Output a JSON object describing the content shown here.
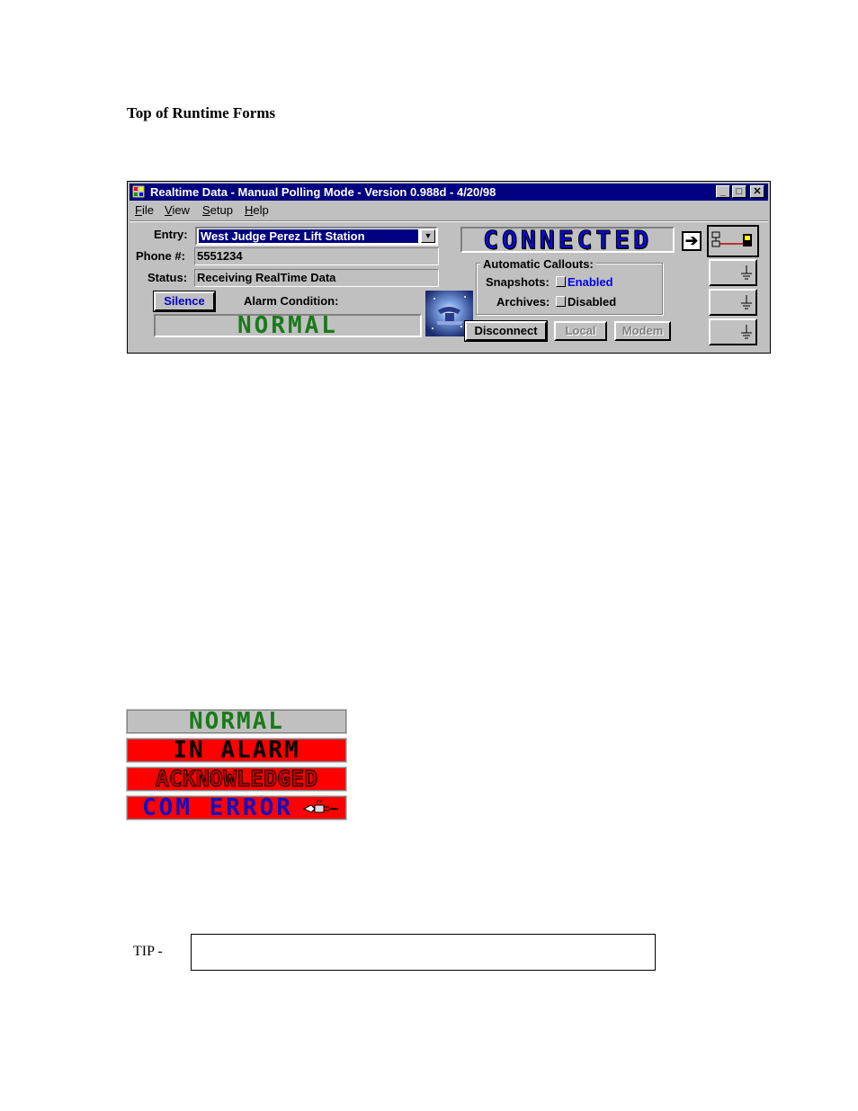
{
  "document": {
    "heading": "Top of Runtime Forms",
    "tip_label": "TIP -"
  },
  "window": {
    "title": "Realtime Data - Manual Polling Mode - Version 0.988d - 4/20/98",
    "controls": {
      "minimize": "_",
      "maximize": "□",
      "close": "✕"
    },
    "menu": [
      {
        "label": "File",
        "accel": "F",
        "rest": "ile"
      },
      {
        "label": "View",
        "accel": "V",
        "rest": "iew"
      },
      {
        "label": "Setup",
        "accel": "S",
        "rest": "etup"
      },
      {
        "label": "Help",
        "accel": "H",
        "rest": "elp"
      }
    ]
  },
  "form": {
    "entry_label": "Entry:",
    "entry_value": "West Judge Perez Lift Station",
    "phone_label": "Phone #:",
    "phone_value": "5551234",
    "status_label": "Status:",
    "status_value": "Receiving RealTime Data",
    "silence_label": "Silence",
    "alarm_condition_label": "Alarm Condition:",
    "alarm_condition_value": "NORMAL",
    "connection_status": "CONNECTED",
    "callouts": {
      "title": "Automatic Callouts:",
      "snapshots_label": "Snapshots:",
      "snapshots_value": "Enabled",
      "archives_label": "Archives:",
      "archives_value": "Disabled"
    },
    "buttons": {
      "disconnect": "Disconnect",
      "local": "Local",
      "modem": "Modem"
    }
  },
  "status_banners": [
    {
      "text": "NORMAL"
    },
    {
      "text": "IN ALARM"
    },
    {
      "text": "ACKNOWLEDGED"
    },
    {
      "text": "COM ERROR"
    }
  ],
  "colors": {
    "titlebar": "#000080",
    "window_face": "#c0c0c0",
    "connected_text": "#0a0ad8",
    "normal_text": "#1a7a1a",
    "alarm_bg": "#ff0000",
    "enabled_text": "#0000ee"
  }
}
